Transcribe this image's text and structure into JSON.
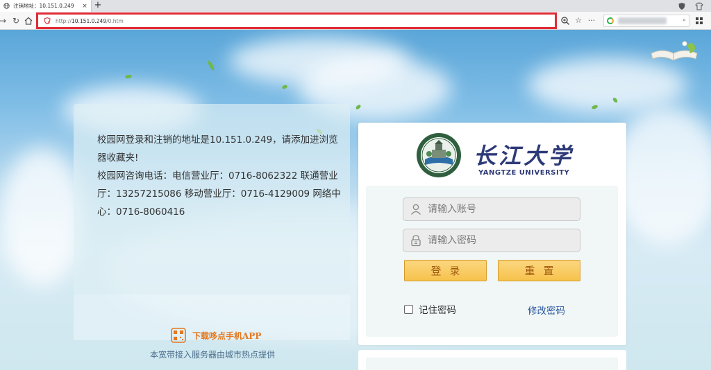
{
  "browser": {
    "tab_title": "注销地址：10.151.0.249",
    "tab_close": "×",
    "new_tab": "+",
    "url_scheme": "http://",
    "url_host": "10.151.0.249",
    "url_path": "/0.htm",
    "icons": [
      "globe-icon",
      "back-icon",
      "reload-icon",
      "home-icon",
      "shield-icon",
      "zoom-icon",
      "star-icon",
      "more-icon",
      "search-icon",
      "grid-icon"
    ]
  },
  "notice": {
    "line1": "校园网登录和注销的地址是10.151.0.249，请添加进浏览器收藏夹!",
    "line2": "校园网咨询电话：电信营业厅：0716-8062322 联通营业厅：13257215086 移动营业厅：0716-4129009 网络中心：0716-8060416"
  },
  "app_promo": {
    "label": "下载哆点手机APP",
    "provider": "本宽带接入服务器由城市热点提供"
  },
  "university": {
    "name_cn": "长江大学",
    "name_en": "YANGTZE UNIVERSITY"
  },
  "login": {
    "account_placeholder": "请输入账号",
    "password_placeholder": "请输入密码",
    "login_label": "登录",
    "reset_label": "重置",
    "remember_label": "记住密码",
    "change_password_label": "修改密码"
  },
  "colors": {
    "highlight_border": "#e02b36",
    "button_fill": "#f6c24c",
    "link": "#2c5aa0",
    "app_label": "#e4781f",
    "brand_navy": "#2d3a78"
  }
}
